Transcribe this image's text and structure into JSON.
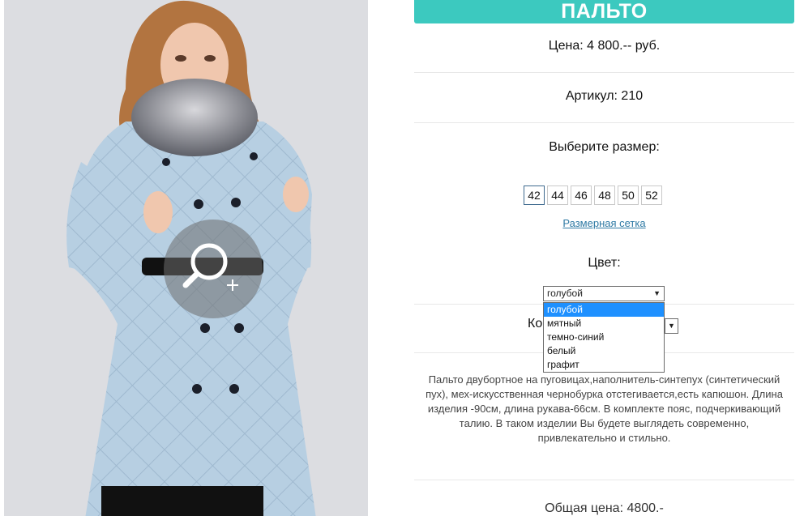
{
  "product": {
    "title": "ПАЛЬТО",
    "price": "Цена: 4 800.-- руб.",
    "article": "Артикул: 210",
    "size_prompt": "Выберите размер:",
    "sizes": [
      "42",
      "44",
      "46",
      "48",
      "50",
      "52"
    ],
    "selected_size": "42",
    "size_chart_link": "Размерная сетка",
    "color_label": "Цвет:",
    "color": {
      "selected": "голубой",
      "options": [
        "голубой",
        "мятный",
        "темно-синий",
        "белый",
        "графит"
      ]
    },
    "quantity_label_partial": "Ко",
    "description": "Пальто двубортное на пуговицах,наполнитель-синтепух (синтетический пух), мех-искусственная чернобурка отстегивается,есть капюшон. Длина изделия -90см, длина рукава-66см. В комплекте пояс, подчеркивающий талию. В таком изделии Вы будете выглядеть современно, привлекательно и стильно.",
    "total": "Общая цена: 4800.-"
  },
  "icons": {
    "zoom": "zoom-in-magnifier-icon",
    "dropdown_arrow": "triangle-down-icon"
  },
  "colors": {
    "accent": "#3cc9bf",
    "link": "#2f7aa4",
    "selected_option": "#1e90ff",
    "coat": "#b9cfe0"
  }
}
